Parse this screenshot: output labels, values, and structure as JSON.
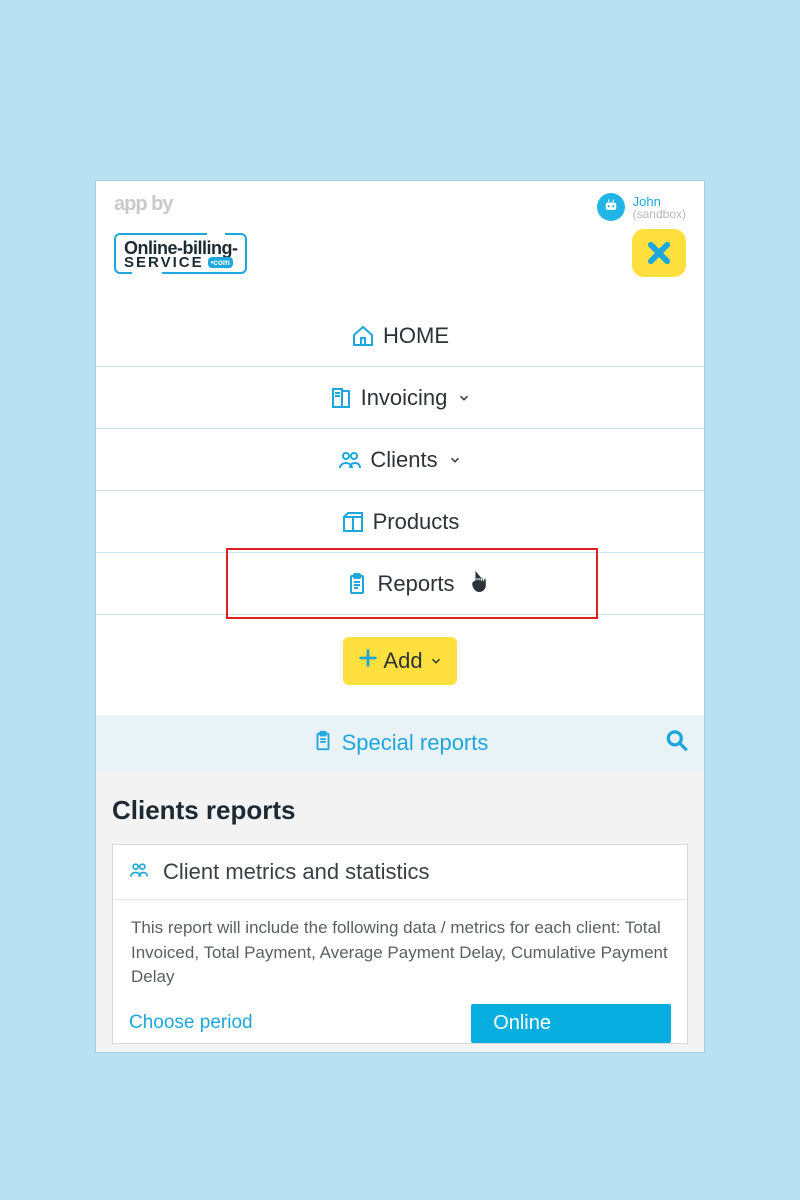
{
  "header": {
    "app_by": "app by",
    "user_name": "John",
    "user_sub": "(sandbox)",
    "logo_line1": "Online-billing-",
    "logo_line2": "service",
    "logo_dotcom": "•com"
  },
  "nav": {
    "items": [
      {
        "label": "HOME",
        "icon": "home",
        "dropdown": false,
        "highlight": false
      },
      {
        "label": "Invoicing",
        "icon": "invoice",
        "dropdown": true,
        "highlight": false
      },
      {
        "label": "Clients",
        "icon": "clients",
        "dropdown": true,
        "highlight": false
      },
      {
        "label": "Products",
        "icon": "products",
        "dropdown": false,
        "highlight": false
      },
      {
        "label": "Reports",
        "icon": "clipboard",
        "dropdown": false,
        "highlight": true
      }
    ],
    "add_label": "Add"
  },
  "strip": {
    "label": "Special reports"
  },
  "main": {
    "title": "Clients reports",
    "card_title": "Client metrics and statistics",
    "card_body": "This report will include the following data / metrics for each client: Total Invoiced, Total Payment, Average Payment Delay, Cumulative Payment Delay",
    "choose_label": "Choose period",
    "action_label": "Online"
  }
}
